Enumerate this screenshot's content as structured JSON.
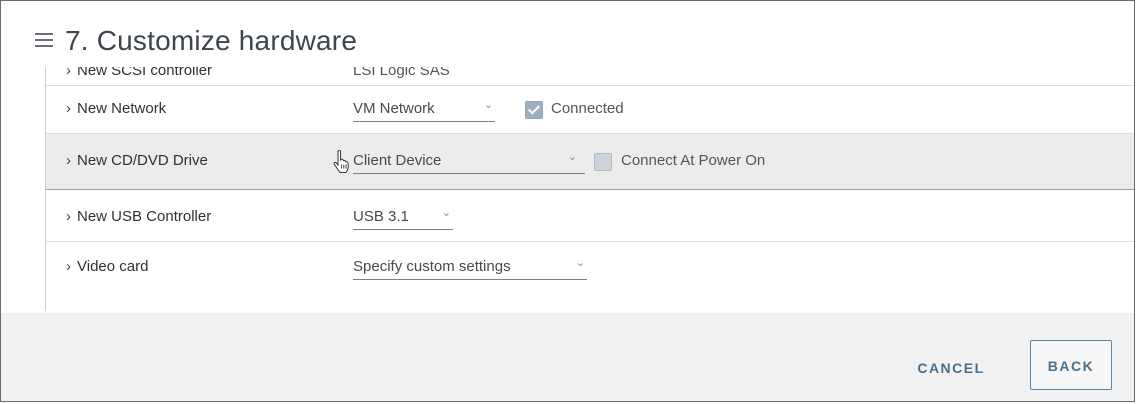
{
  "header": {
    "title": "7. Customize hardware"
  },
  "rows": [
    {
      "label": "New SCSI controller",
      "value": "LSI Logic SAS"
    },
    {
      "label": "New Network",
      "value": "VM Network",
      "checkbox_label": "Connected",
      "checked": true
    },
    {
      "label": "New CD/DVD Drive",
      "value": "Client Device",
      "checkbox_label": "Connect At Power On",
      "checked": false
    },
    {
      "label": "New USB Controller",
      "value": "USB 3.1"
    },
    {
      "label": "Video card",
      "value": "Specify custom settings"
    }
  ],
  "icons": {
    "chevron": "›",
    "caret": "⌄"
  },
  "footer": {
    "cancel_label": "CANCEL",
    "back_label": "BACK"
  },
  "colors": {
    "accent": "#4a6f8b",
    "active_row": "#ececec",
    "checkbox": "#9eb0bf"
  }
}
